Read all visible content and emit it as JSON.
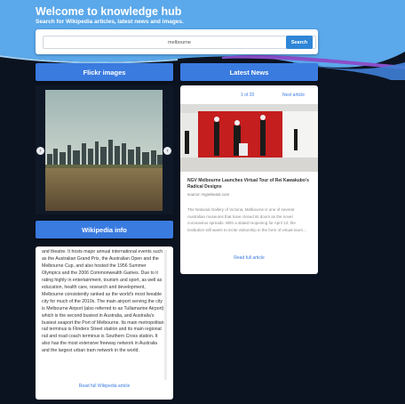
{
  "header": {
    "title": "Welcome to knowledge hub",
    "subtitle": "Search for Wikipedia articles, latest news and images."
  },
  "search": {
    "value": "melbourne",
    "button_label": "Search"
  },
  "flickr": {
    "label": "Flickr images",
    "prev_icon": "chevron-left-icon",
    "next_icon": "chevron-right-icon"
  },
  "news": {
    "label": "Latest News",
    "pager": "1 of 20",
    "next_label": "Next article",
    "title": "NGV Melbourne Launches Virtual Tour of Rei Kawakubo's Radical Designs",
    "source": "source: Hypebeast.com",
    "body": "The National Gallery of Victoria, Melbourne is one of several Australian museums that have closed its doors as the novel coronavirus spreads. With a slated reopening for April 13, the institution still wants to incite visitorship in the form of virtual tours....",
    "read_full": "Read full article"
  },
  "wiki": {
    "label": "Wikipedia info",
    "text": "and theatre. It hosts major annual international events such as the Australian Grand Prix, the Australian Open and the Melbourne Cup, and also hosted the 1956 Summer Olympics and the 2006 Commonwealth Games. Due to it rating highly in entertainment, tourism and sport, as well as education, health care, research and development, Melbourne consistently ranked as the world's most liveable city for much of the 2010s. The main airport serving the city is Melbourne Airport (also referred to as Tullamarine Airport), which is the second busiest in Australia, and Australia's busiest seaport the Port of Melbourne. Its main metropolitan rail terminus is Flinders Street station and its main regional rail and road coach terminus is Southern Cross station. It also has the most extensive freeway network in Australia and the largest urban tram network in the world.",
    "read_full": "Read full Wikipedia article"
  },
  "colors": {
    "accent": "#3a7be0",
    "background": "#0c1320",
    "wave_blue": "#5aa7e8",
    "wave_purple": "#8a4fc9"
  }
}
